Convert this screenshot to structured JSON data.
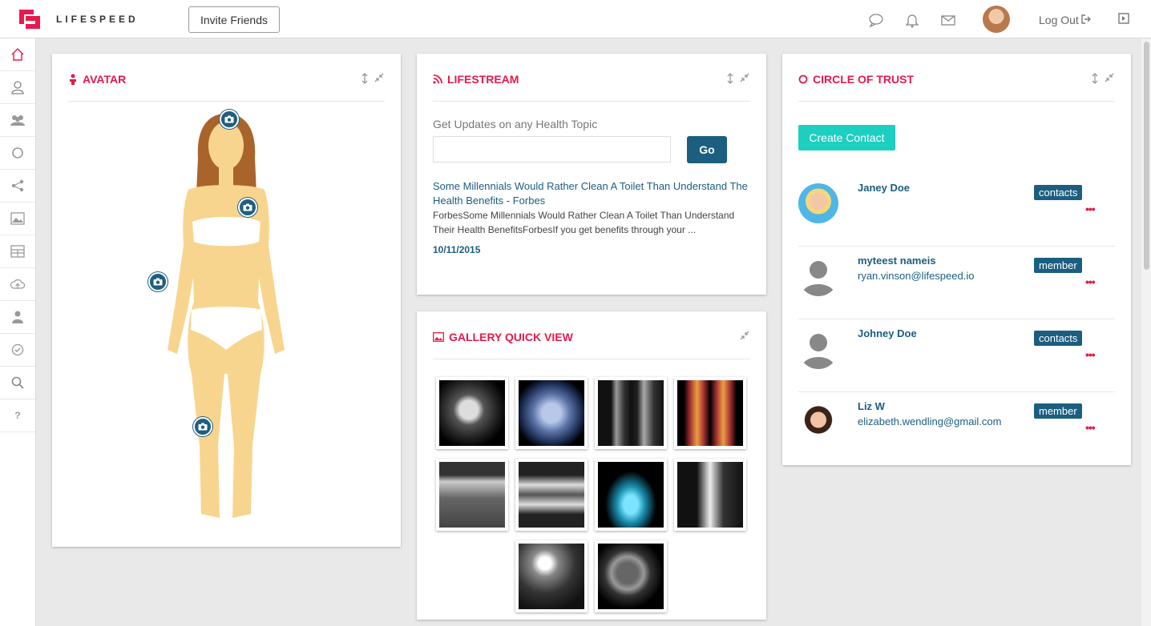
{
  "header": {
    "brand": "LIFESPEED",
    "invite_label": "Invite Friends",
    "logout_label": "Log Out",
    "icons": [
      "chat-icon",
      "bell-icon",
      "mail-icon"
    ],
    "accent": "#e8194b"
  },
  "sidebar": {
    "items": [
      "home-icon",
      "user-icon",
      "group-icon",
      "circle-icon",
      "share-icon",
      "image-icon",
      "dashboard-icon",
      "cloud-upload-icon",
      "doctor-icon",
      "check-icon",
      "search-icon"
    ],
    "help": "?"
  },
  "avatar": {
    "title": "AVATAR"
  },
  "lifestream": {
    "title": "LIFESTREAM",
    "label": "Get Updates on any Health Topic",
    "input_value": "",
    "go_label": "Go",
    "news": {
      "title": "Some Millennials Would Rather Clean A Toilet Than Understand The Health Benefits - Forbes",
      "body": "ForbesSome Millennials Would Rather Clean A Toilet Than Understand Their Health BenefitsForbesIf you get benefits through your ...",
      "date": "10/11/2015"
    }
  },
  "gallery": {
    "title": "GALLERY QUICK VIEW",
    "images": [
      "brain-mri",
      "skull-3d",
      "spine-xray",
      "body-scan",
      "dental-xray-1",
      "dental-xray-2",
      "hand-xray",
      "femur-xray",
      "hip-implant-xray",
      "head-ct"
    ]
  },
  "circle_of_trust": {
    "title": "CIRCLE OF TRUST",
    "create_label": "Create Contact",
    "contacts": [
      {
        "name": "Janey Doe",
        "email": "",
        "role": "contacts"
      },
      {
        "name": "myteest nameis",
        "email": "ryan.vinson@lifespeed.io",
        "role": "member"
      },
      {
        "name": "Johney Doe",
        "email": "",
        "role": "contacts"
      },
      {
        "name": "Liz W",
        "email": "elizabeth.wendling@gmail.com",
        "role": "member"
      }
    ],
    "more": "•••"
  }
}
